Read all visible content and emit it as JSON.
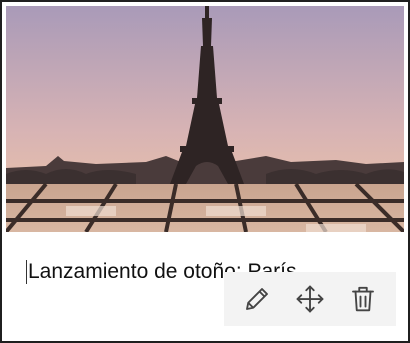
{
  "card": {
    "caption": "Lanzamiento de otoño: París",
    "image_subject": "eiffel-tower-at-dusk"
  },
  "toolbar": {
    "icons": [
      "pencil-icon",
      "move-icon",
      "trash-icon"
    ]
  },
  "colors": {
    "icon": "#444444",
    "toolbar_bg": "#f3f3f3",
    "sky_top": "#a99ab8",
    "sky_bottom": "#f1c7a4"
  }
}
